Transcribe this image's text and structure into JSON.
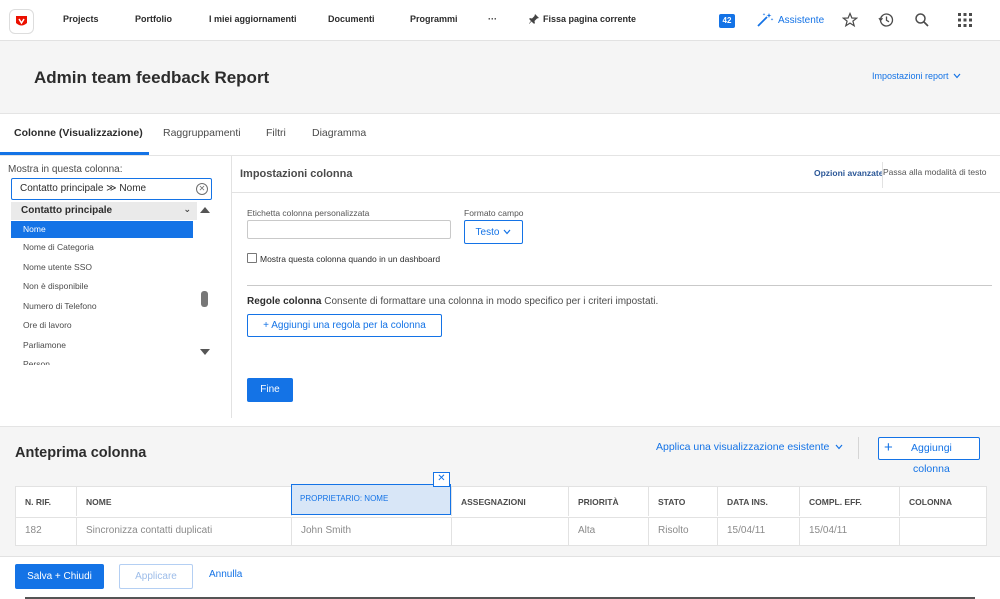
{
  "topnav": {
    "logo_icon": "workfront-logo-icon",
    "items": [
      "Projects",
      "Portfolio",
      "I miei aggiornamenti",
      "Documenti",
      "Programmi"
    ],
    "more": "···",
    "pin_label": "Fissa pagina corrente",
    "notifications_count": "42",
    "assistant_label": "Assistente",
    "icons": [
      "star-icon",
      "history-icon",
      "search-icon",
      "app-grid-icon"
    ]
  },
  "header": {
    "title": "Admin team feedback Report",
    "settings_label": "Impostazioni report"
  },
  "tabs": [
    {
      "label": "Colonne (Visualizzazione)",
      "active": true
    },
    {
      "label": "Raggruppamenti",
      "active": false
    },
    {
      "label": "Filtri",
      "active": false
    },
    {
      "label": "Diagramma",
      "active": false
    }
  ],
  "field_picker": {
    "label": "Mostra in questa colonna:",
    "value": "Contatto principale  ≫  Nome",
    "group": "Contatto principale",
    "items": [
      "Nome",
      "Nome di Categoria",
      "Nome utente SSO",
      "Non è disponibile",
      "Numero di Telefono",
      "Ore di lavoro",
      "Parliamone",
      "Person"
    ],
    "selected_index": 0
  },
  "column_settings": {
    "title": "Impostazioni colonna",
    "advanced_label": "Opzioni avanzate",
    "text_mode_label": "Passa alla modalità di testo",
    "custom_label_caption": "Etichetta colonna personalizzata",
    "custom_label_value": "",
    "format_caption": "Formato campo",
    "format_value": "Testo",
    "dashboard_checkbox_label": "Mostra questa colonna quando in un dashboard",
    "dashboard_checked": false,
    "rules_title": "Regole colonna",
    "rules_desc": "Consente di formattare una colonna in modo specifico per i criteri impostati.",
    "add_rule_label": "+ Aggiungi una regola per la colonna",
    "done_label": "Fine"
  },
  "preview": {
    "title": "Anteprima colonna",
    "apply_view_label": "Applica una visualizzazione esistente",
    "add_column_line1": "Aggiungi",
    "add_column_line2": "colonna",
    "close_symbol": "✕",
    "columns": [
      "N. RIF.",
      "NOME",
      "PROPRIETARIO: NOME",
      "ASSEGNAZIONI",
      "PRIORITÀ",
      "STATO",
      "DATA INS.",
      "COMPL. EFF.",
      "COLONNA"
    ],
    "row": [
      "182",
      "Sincronizza contatti duplicati",
      "John Smith",
      "",
      "Alta",
      "Risolto",
      "15/04/11",
      "15/04/11",
      ""
    ]
  },
  "footer": {
    "save_label": "Salva + Chiudi",
    "apply_label": "Applicare",
    "cancel_label": "Annulla"
  },
  "colors": {
    "accent": "#1473e6"
  }
}
